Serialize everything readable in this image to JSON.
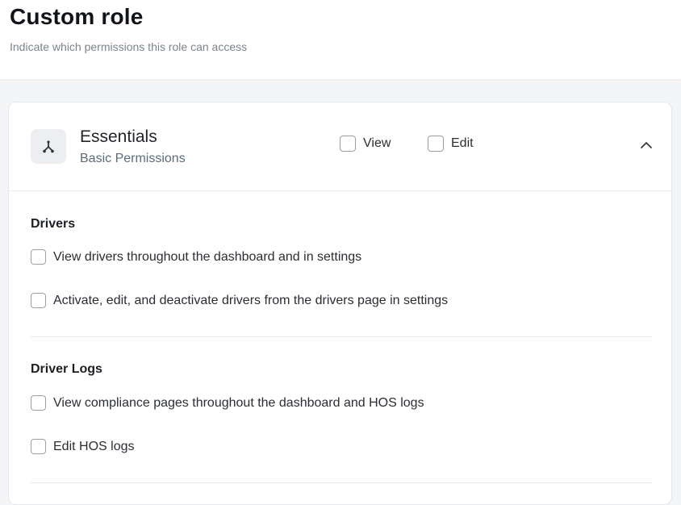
{
  "header": {
    "title": "Custom role",
    "subtitle": "Indicate which permissions this role can access"
  },
  "section": {
    "icon": "fork-icon",
    "title": "Essentials",
    "subtitle": "Basic Permissions",
    "view_label": "View",
    "edit_label": "Edit",
    "collapse_icon": "chevron-up-icon",
    "groups": [
      {
        "title": "Drivers",
        "permissions": [
          "View drivers throughout the dashboard and in settings",
          "Activate, edit, and deactivate drivers from the drivers page in settings"
        ]
      },
      {
        "title": "Driver Logs",
        "permissions": [
          "View compliance pages throughout the dashboard and HOS logs",
          "Edit HOS logs"
        ]
      }
    ]
  },
  "colors": {
    "page_bg": "#f4f5f7",
    "card_bg": "#ffffff",
    "subtitle_text": "#5c6b7a",
    "checkbox_border": "#9aa0a6"
  }
}
